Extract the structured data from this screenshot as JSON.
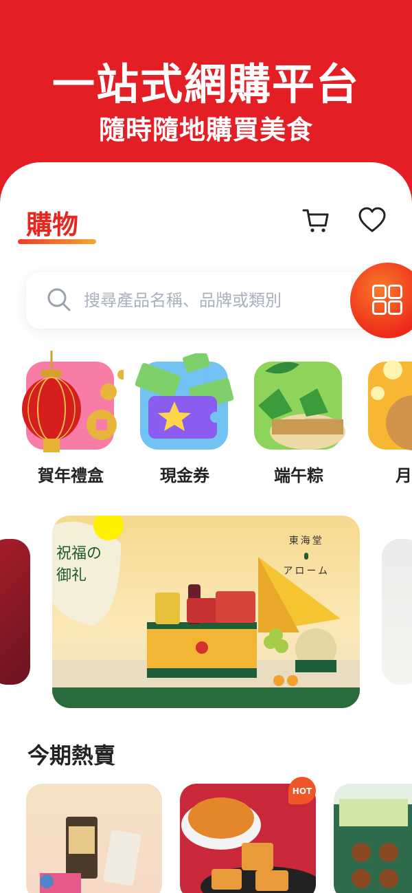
{
  "hero": {
    "title": "一站式網購平台",
    "subtitle": "隨時隨地購買美食"
  },
  "header": {
    "tab_title": "購物",
    "cart_icon": "cart-icon",
    "wishlist_icon": "heart-icon"
  },
  "search": {
    "placeholder": "搜尋產品名稱、品牌或類別",
    "icon": "search-icon",
    "menu_icon": "grid-icon"
  },
  "categories": [
    {
      "label": "賀年禮盒",
      "icon": "lantern-icon"
    },
    {
      "label": "現金券",
      "icon": "voucher-icon"
    },
    {
      "label": "端午粽",
      "icon": "rice-dumpling-icon"
    },
    {
      "label": "月",
      "icon": "mooncake-icon"
    }
  ],
  "banner": {
    "brand_line1": "東海堂",
    "brand_line2": "アローム",
    "calligraphy": "祝福の御礼"
  },
  "hot_section": {
    "title": "今期熱賣",
    "badge": "HOT"
  },
  "colors": {
    "brand_red": "#e31e24",
    "accent_orange": "#f7a62c"
  }
}
